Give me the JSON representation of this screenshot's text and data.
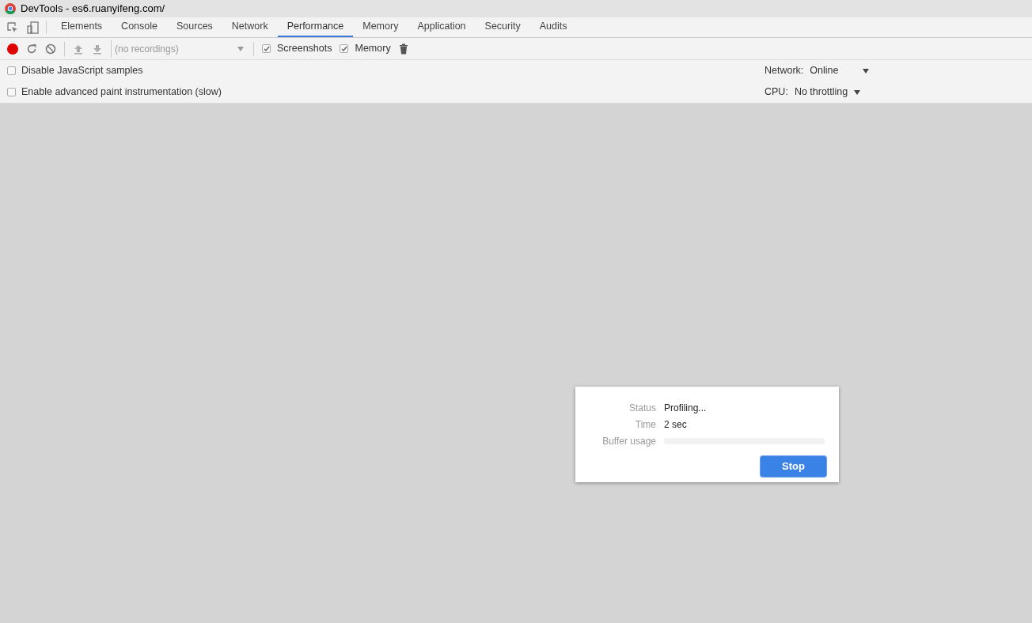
{
  "window": {
    "title": "DevTools - es6.ruanyifeng.com/"
  },
  "tabs": [
    {
      "label": "Elements",
      "selected": false
    },
    {
      "label": "Console",
      "selected": false
    },
    {
      "label": "Sources",
      "selected": false
    },
    {
      "label": "Network",
      "selected": false
    },
    {
      "label": "Performance",
      "selected": true
    },
    {
      "label": "Memory",
      "selected": false
    },
    {
      "label": "Application",
      "selected": false
    },
    {
      "label": "Security",
      "selected": false
    },
    {
      "label": "Audits",
      "selected": false
    }
  ],
  "toolbar": {
    "recording": true,
    "recordings_select": {
      "placeholder": "(no recordings)"
    },
    "checkboxes": [
      {
        "label": "Screenshots",
        "checked": true
      },
      {
        "label": "Memory",
        "checked": true
      }
    ]
  },
  "settings": [
    {
      "label": "Disable JavaScript samples",
      "checked": false,
      "throttle_label": "Network:",
      "throttle_value": "Online"
    },
    {
      "label": "Enable advanced paint instrumentation (slow)",
      "checked": false,
      "throttle_label": "CPU:",
      "throttle_value": "No throttling"
    }
  ],
  "dialog": {
    "rows": [
      {
        "label": "Status",
        "value": "Profiling..."
      },
      {
        "label": "Time",
        "value": "2 sec"
      }
    ],
    "buffer": {
      "label": "Buffer usage",
      "level": 0
    },
    "button": "Stop"
  }
}
